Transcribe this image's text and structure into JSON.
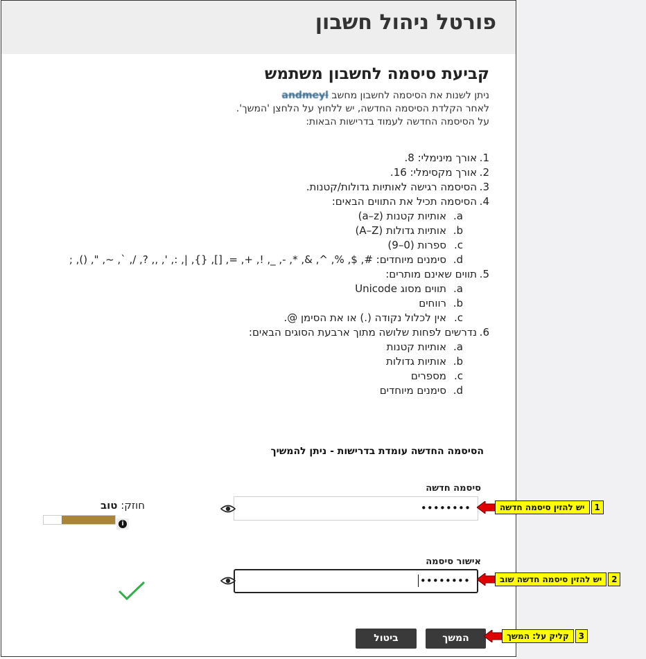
{
  "portal_title": "פורטל ניהול חשבון",
  "page_title": "קביעת סיסמה לחשבון משתמש",
  "intro": {
    "line1_prefix": "ניתן לשנות את הסיסמה לחשבון מחשב ",
    "account_name": "andmeyl",
    "line2": "לאחר הקלדת הסיסמה החדשה, יש ללחוץ על הלחצן 'המשך'.",
    "line3": "על הסיסמה החדשה לעמוד בדרישות הבאות:"
  },
  "requirements": [
    {
      "num": "1.",
      "text": "אורך מינימלי: 8."
    },
    {
      "num": "2.",
      "text": "אורך מקסימלי: 16."
    },
    {
      "num": "3.",
      "text": "הסיסמה רגישה לאותיות גדולות/קטנות."
    },
    {
      "num": "4.",
      "text": "הסיסמה תכיל את התווים הבאים:",
      "subs": [
        {
          "num": "a.",
          "text": "אותיות קטנות (a–z)"
        },
        {
          "num": "b.",
          "text": "אותיות גדולות (A–Z)"
        },
        {
          "num": "c.",
          "text": "ספרות (0–9)"
        },
        {
          "num": "d.",
          "text": "סימנים מיוחדים: #, $, %, ^, &, *, -, _, !, +, =, [], {}, |, :, ', ,, ?, /, `, ~, \", (), ;"
        }
      ]
    },
    {
      "num": "5.",
      "text": "תווים שאינם מותרים:",
      "subs": [
        {
          "num": "a.",
          "text": "תווים מסוג Unicode"
        },
        {
          "num": "b.",
          "text": "רווחים"
        },
        {
          "num": "c.",
          "text": "אין לכלול נקודה (.) או את הסימן @."
        }
      ]
    },
    {
      "num": "6.",
      "text": "נדרשים לפחות שלושה מתוך ארבעת הסוגים הבאים:",
      "subs": [
        {
          "num": "a.",
          "text": "אותיות קטנות"
        },
        {
          "num": "b.",
          "text": "אותיות גדולות"
        },
        {
          "num": "c.",
          "text": "מספרים"
        },
        {
          "num": "d.",
          "text": "סימנים מיוחדים"
        }
      ]
    }
  ],
  "status_message": "הסיסמה החדשה עומדת בדרישות - ניתן להמשיך",
  "new_password": {
    "label": "סיסמה חדשה",
    "value": "••••••••"
  },
  "confirm_password": {
    "label": "אישור סיסמה",
    "value": "••••••••"
  },
  "strength": {
    "label": "חוזק:",
    "value": "טוב",
    "level": 0.75,
    "color": "#a9853a",
    "info_glyph": "i"
  },
  "buttons": {
    "continue": "המשך",
    "cancel": "ביטול"
  },
  "callouts": [
    {
      "num": "1",
      "text": "יש להזין סיסמה חדשה"
    },
    {
      "num": "2",
      "text": "יש להזין סיסמה חדשה שוב"
    },
    {
      "num": "3",
      "text": "קליק על: המשך"
    }
  ],
  "colors": {
    "accent_check": "#2fb04a",
    "button_bg": "#3a3a3a",
    "callout_bg": "#ffff00",
    "arrow": "#e00000"
  }
}
